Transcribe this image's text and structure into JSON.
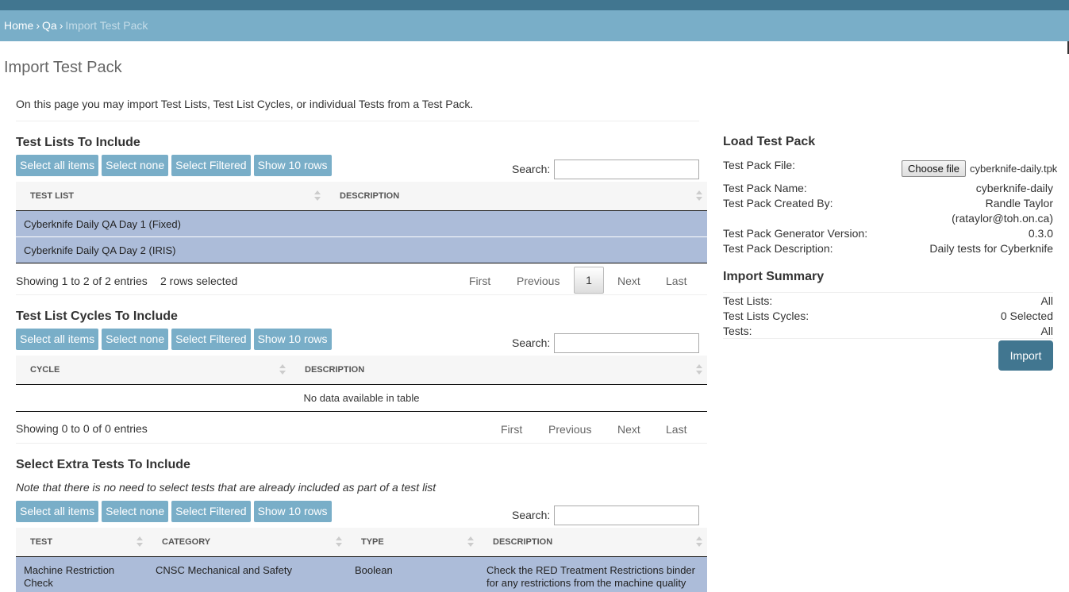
{
  "breadcrumb": {
    "home": "Home",
    "sep1": "›",
    "qa": "Qa",
    "sep2": "›",
    "current": "Import Test Pack"
  },
  "page": {
    "title": "Import Test Pack",
    "intro": "On this page you may import Test Lists, Test List Cycles, or individual Tests from a Test Pack."
  },
  "buttons": {
    "select_all": "Select all items",
    "select_none": "Select none",
    "select_filtered": "Select Filtered",
    "show_rows": "Show 10 rows"
  },
  "search_label": "Search:",
  "pager": {
    "first": "First",
    "previous": "Previous",
    "page": "1",
    "next": "Next",
    "last": "Last"
  },
  "test_lists": {
    "title": "Test Lists To Include",
    "headers": [
      "Test List",
      "Description"
    ],
    "rows": [
      {
        "name": "Cyberknife Daily QA Day 1 (Fixed)",
        "description": ""
      },
      {
        "name": "Cyberknife Daily QA Day 2 (IRIS)",
        "description": ""
      }
    ],
    "info": "Showing 1 to 2 of 2 entries",
    "selected": "2 rows selected"
  },
  "cycles": {
    "title": "Test List Cycles To Include",
    "headers": [
      "Cycle",
      "Description"
    ],
    "empty": "No data available in table",
    "info": "Showing 0 to 0 of 0 entries"
  },
  "tests": {
    "title": "Select Extra Tests To Include",
    "note": "Note that there is no need to select tests that are already included as part of a test list",
    "headers": [
      "Test",
      "Category",
      "Type",
      "Description"
    ],
    "rows": [
      {
        "test_line1": "Machine Restriction",
        "test_line2": "Check",
        "category": "CNSC Mechanical and Safety",
        "type": "Boolean",
        "desc_line1": "Check the RED Treatment Restrictions binder",
        "desc_line2": "for any restrictions from the machine quality"
      }
    ]
  },
  "load": {
    "title": "Load Test Pack",
    "file_label": "Test Pack File:",
    "choose_file": "Choose file",
    "file_name": "cyberknife-daily.tpk",
    "name_label": "Test Pack Name:",
    "name_value": "cyberknife-daily",
    "created_label": "Test Pack Created By:",
    "created_value": "Randle Taylor",
    "created_email": "(rataylor@toh.on.ca)",
    "version_label": "Test Pack Generator Version:",
    "version_value": "0.3.0",
    "desc_label": "Test Pack Description:",
    "desc_value": "Daily tests for Cyberknife"
  },
  "summary": {
    "title": "Import Summary",
    "lists_label": "Test Lists:",
    "lists_value": "All",
    "cycles_label": "Test Lists Cycles:",
    "cycles_value": "0 Selected",
    "tests_label": "Tests:",
    "tests_value": "All",
    "import_button": "Import"
  }
}
